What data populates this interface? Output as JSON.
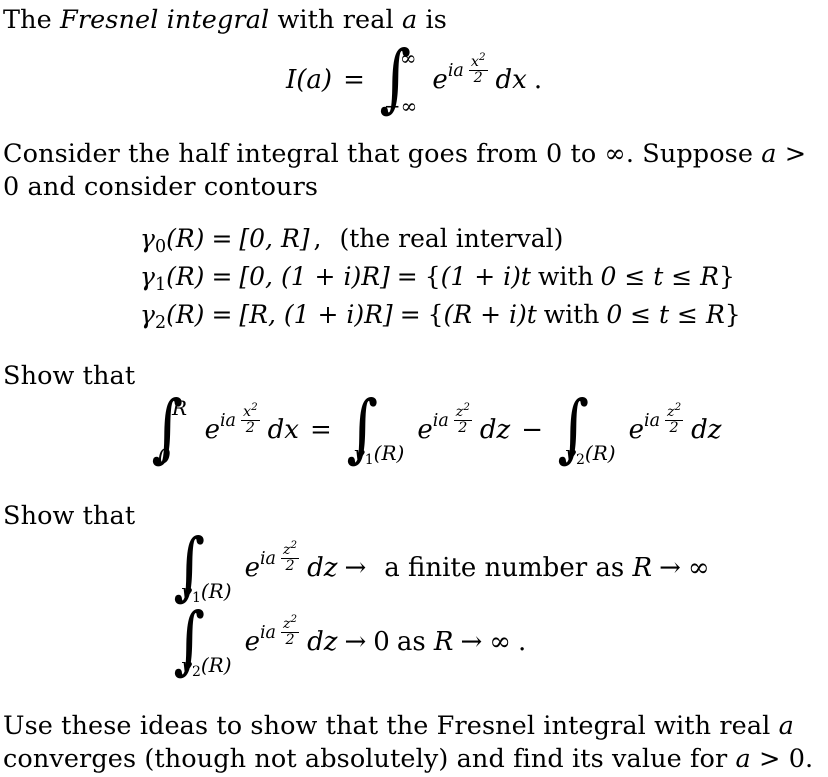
{
  "document": {
    "type": "mathematics-problem-set",
    "topic": "Fresnel integral",
    "intro": {
      "before_emph": "The ",
      "emph": "Fresnel integral",
      "after_emph": " with real ",
      "variable": "a",
      "tail": " is"
    },
    "equation_fresnel": {
      "lhs": "I(a)",
      "equals": "=",
      "integral_lower": "−∞",
      "integral_upper": "∞",
      "integrand_base": "e",
      "exponent_prefix": "ia",
      "exponent_numerator": "x",
      "exponent_numerator_power": "2",
      "exponent_denominator": "2",
      "differential": "dx",
      "period": "."
    },
    "paragraph_consider": {
      "text_1": "Consider the half integral that goes from 0 to ∞.  Suppose ",
      "var_a": "a",
      "text_2": " > 0 and consider contours"
    },
    "contours": [
      {
        "name": "γ",
        "sub": "0",
        "arg": "(R)",
        "equals": "=",
        "set": "[0, R]",
        "comma": ",",
        "note": "(the real interval)"
      },
      {
        "name": "γ",
        "sub": "1",
        "arg": "(R)",
        "equals": "=",
        "set": "[0, (1 + i)R]",
        "equals2": "=",
        "builder_open": "{",
        "builder_expr": "(1 + i)t",
        "builder_with": "with",
        "builder_range": "0 ≤ t ≤ R",
        "builder_close": "}"
      },
      {
        "name": "γ",
        "sub": "2",
        "arg": "(R)",
        "equals": "=",
        "set": "[R, (1 + i)R]",
        "equals2": "=",
        "builder_open": "{",
        "builder_expr": "(R + i)t",
        "builder_with": "with",
        "builder_range": "0 ≤ t ≤ R",
        "builder_close": "}"
      }
    ],
    "show_that_1": "Show that",
    "equation_show1": {
      "int1_lower": "0",
      "int1_upper": "R",
      "base": "e",
      "exp_prefix": "ia",
      "exp_num_x": "x",
      "exp_num_x_pow": "2",
      "exp_den": "2",
      "dx": "dx",
      "equals": "=",
      "int2_lower_gamma": "γ",
      "int2_lower_sub": "1",
      "int2_lower_arg": "(R)",
      "exp_num_z": "z",
      "exp_num_z_pow": "2",
      "dz": "dz",
      "minus": "−",
      "int3_lower_gamma": "γ",
      "int3_lower_sub": "2",
      "int3_lower_arg": "(R)"
    },
    "show_that_2": "Show that",
    "equation_show2a": {
      "int_lower_gamma": "γ",
      "int_lower_sub": "1",
      "int_lower_arg": "(R)",
      "base": "e",
      "exp_prefix": "ia",
      "exp_num": "z",
      "exp_num_pow": "2",
      "exp_den": "2",
      "dz": "dz",
      "arrow": "→",
      "text_finite": "a finite number as ",
      "var_R": "R",
      "arrow2": "→",
      "infinity": "∞"
    },
    "equation_show2b": {
      "int_lower_gamma": "γ",
      "int_lower_sub": "2",
      "int_lower_arg": "(R)",
      "base": "e",
      "exp_prefix": "ia",
      "exp_num": "z",
      "exp_num_pow": "2",
      "exp_den": "2",
      "dz": "dz",
      "arrow": "→",
      "limit_value": "0",
      "text_as": "as ",
      "var_R": "R",
      "arrow2": "→",
      "infinity": "∞",
      "period": "."
    },
    "paragraph_final": {
      "text_1": "Use these ideas to show that the Fresnel integral with real ",
      "var_a": "a",
      "text_2": " converges (though not absolutely) and find its value for ",
      "var_a2": "a",
      "text_3": " > 0."
    }
  },
  "colors": {
    "background": "#ffffff",
    "text": "#000000"
  }
}
